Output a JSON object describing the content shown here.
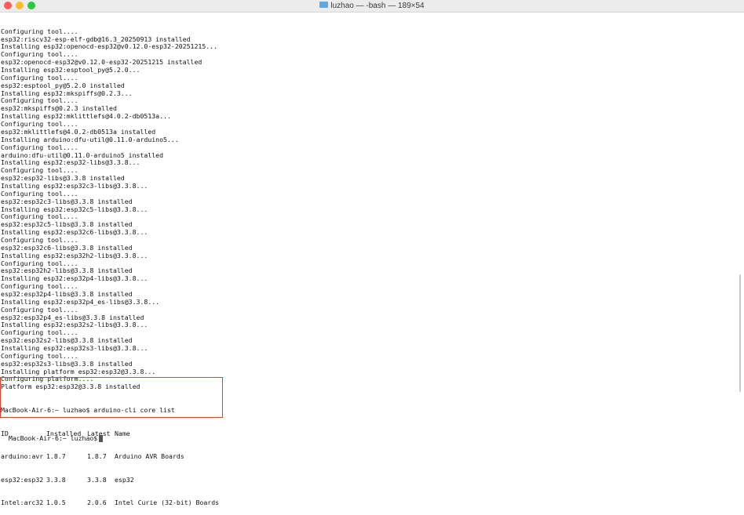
{
  "window": {
    "title": "luzhao — -bash — 189×54"
  },
  "terminal": {
    "lines": [
      "Configuring tool....",
      "esp32:riscv32-esp-elf-gdb@16.3_20250913 installed",
      "Installing esp32:openocd-esp32@v0.12.0-esp32-20251215...",
      "Configuring tool....",
      "esp32:openocd-esp32@v0.12.0-esp32-20251215 installed",
      "Installing esp32:esptool_py@5.2.0...",
      "Configuring tool....",
      "esp32:esptool_py@5.2.0 installed",
      "Installing esp32:mkspiffs@0.2.3...",
      "Configuring tool....",
      "esp32:mkspiffs@0.2.3 installed",
      "Installing esp32:mklittlefs@4.0.2-db0513a...",
      "Configuring tool....",
      "esp32:mklittlefs@4.0.2-db0513a installed",
      "Installing arduino:dfu-util@0.11.0-arduino5...",
      "Configuring tool....",
      "arduino:dfu-util@0.11.0-arduino5 installed",
      "Installing esp32:esp32-libs@3.3.8...",
      "Configuring tool....",
      "esp32:esp32-libs@3.3.8 installed",
      "Installing esp32:esp32c3-libs@3.3.8...",
      "Configuring tool....",
      "esp32:esp32c3-libs@3.3.8 installed",
      "Installing esp32:esp32c5-libs@3.3.8...",
      "Configuring tool....",
      "esp32:esp32c5-libs@3.3.8 installed",
      "Installing esp32:esp32c6-libs@3.3.8...",
      "Configuring tool....",
      "esp32:esp32c6-libs@3.3.8 installed",
      "Installing esp32:esp32h2-libs@3.3.8...",
      "Configuring tool....",
      "esp32:esp32h2-libs@3.3.8 installed",
      "Installing esp32:esp32p4-libs@3.3.8...",
      "Configuring tool....",
      "esp32:esp32p4-libs@3.3.8 installed",
      "Installing esp32:esp32p4_es-libs@3.3.8...",
      "Configuring tool....",
      "esp32:esp32p4_es-libs@3.3.8 installed",
      "Installing esp32:esp32s2-libs@3.3.8...",
      "Configuring tool....",
      "esp32:esp32s2-libs@3.3.8 installed",
      "Installing esp32:esp32s3-libs@3.3.8...",
      "Configuring tool....",
      "esp32:esp32s3-libs@3.3.8 installed",
      "Installing platform esp32:esp32@3.3.8...",
      "Configuring platform....",
      "Platform esp32:esp32@3.3.8 installed"
    ],
    "command_line": "MacBook-Air-6:~ luzhao$ arduino-cli core list",
    "table_headers": [
      "ID",
      "Installed",
      "Latest",
      "Name"
    ],
    "table_rows": [
      [
        "arduino:avr",
        "1.8.7",
        "1.8.7",
        "Arduino AVR Boards"
      ],
      [
        "esp32:esp32",
        "3.3.8",
        "3.3.8",
        "esp32"
      ],
      [
        "Intel:arc32",
        "1.0.5",
        "2.0.6",
        "Intel Curie (32-bit) Boards"
      ]
    ],
    "prompt": "MacBook-Air-6:~ luzhao$"
  },
  "colors": {
    "highlight_border": "#e0412f",
    "text": "#111111"
  }
}
